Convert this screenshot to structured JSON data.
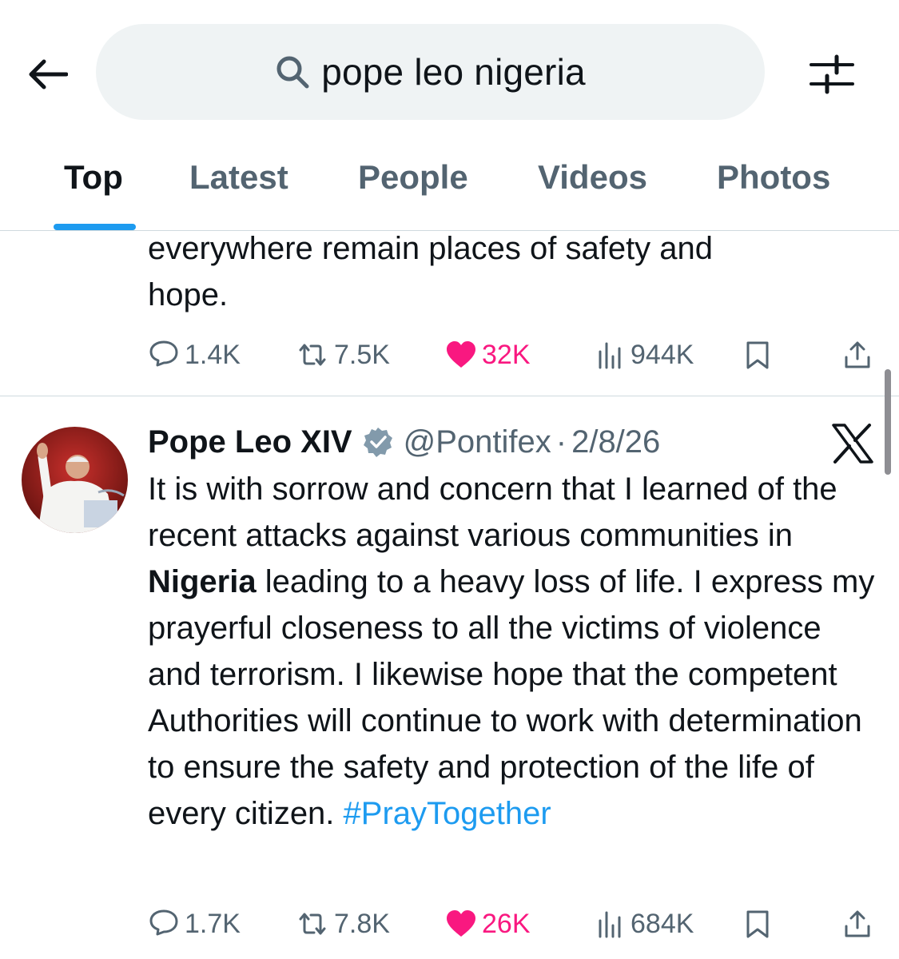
{
  "search": {
    "query": "pope leo nigeria"
  },
  "tabs": [
    {
      "label": "Top"
    },
    {
      "label": "Latest"
    },
    {
      "label": "People"
    },
    {
      "label": "Videos"
    },
    {
      "label": "Photos"
    }
  ],
  "active_tab": "Top",
  "colors": {
    "accent": "#1d9bf0",
    "like": "#f91880",
    "muted": "#536471",
    "text": "#0f1419"
  },
  "previous_post": {
    "text_lines": [
      "everywhere remain places of safety and",
      "hope."
    ],
    "replies": "1.4K",
    "reposts": "7.5K",
    "likes": "32K",
    "views": "944K"
  },
  "post": {
    "author": "Pope Leo XIV",
    "handle": "@Pontifex",
    "separator": "·",
    "date": "2/8/26",
    "body_before": "It is with sorrow and concern that I learned of the recent attacks against various communities in ",
    "body_bold": "Nigeria",
    "body_after": " leading to a heavy loss of life.  I express my prayerful closeness to all the victims of violence and terrorism.  I likewise hope that the competent Authorities will continue to work with determination to ensure the safety and protection of the life of every citizen. ",
    "hashtag": "#PrayTogether",
    "replies": "1.7K",
    "reposts": "7.8K",
    "likes": "26K",
    "views": "684K"
  },
  "icons": {
    "back": "arrow-left-icon",
    "search": "search-icon",
    "filter": "sliders-icon",
    "reply": "comment-icon",
    "repost": "repost-icon",
    "like": "heart-icon",
    "views": "analytics-icon",
    "bookmark": "bookmark-icon",
    "share": "share-icon",
    "verified": "verified-badge-icon",
    "source": "x-logo-icon"
  }
}
